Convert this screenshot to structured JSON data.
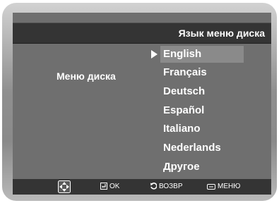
{
  "header": {
    "title": "Язык меню диска"
  },
  "left_label": "Меню диска",
  "languages": {
    "selected_index": 0,
    "items": [
      "English",
      "Français",
      "Deutsch",
      "Español",
      "Italiano",
      "Nederlands",
      "Другое"
    ]
  },
  "footer": {
    "move_icon": "four-way-arrow-icon",
    "ok": {
      "icon": "enter-icon",
      "label": "OK"
    },
    "back": {
      "icon": "return-icon",
      "label": "ВОЗВР"
    },
    "menu": {
      "icon": "menu-icon",
      "label": "МЕНЮ"
    }
  },
  "colors": {
    "screen": "#6f6f6f",
    "bar": "#343434",
    "highlight": "#8a8a8a",
    "text": "#ffffff"
  }
}
